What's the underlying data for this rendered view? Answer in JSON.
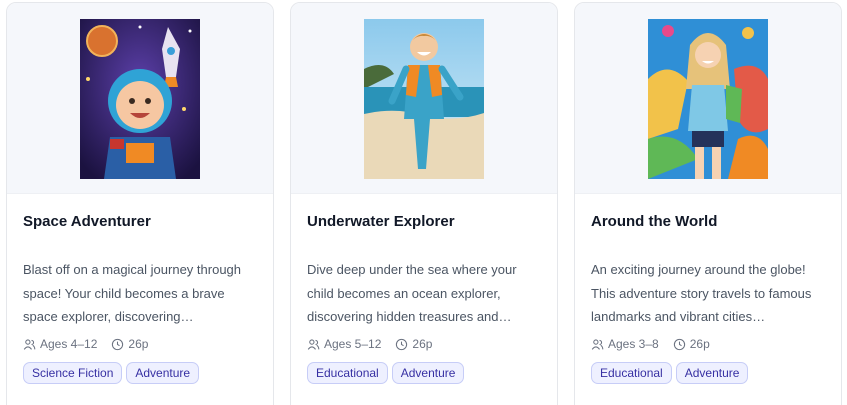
{
  "stories": [
    {
      "title": "Space Adventurer",
      "description": "Blast off on a magical journey through space! Your child becomes a brave space explorer, discovering…",
      "ages": "Ages 4–12",
      "pages": "26p",
      "tags": [
        "Science Fiction",
        "Adventure"
      ],
      "cover_icon": "astronaut-child-cover"
    },
    {
      "title": "Underwater Explorer",
      "description": "Dive deep under the sea where your child becomes an ocean explorer, discovering hidden treasures and…",
      "ages": "Ages 5–12",
      "pages": "26p",
      "tags": [
        "Educational",
        "Adventure"
      ],
      "cover_icon": "beach-diver-child-cover"
    },
    {
      "title": "Around the World",
      "description": "An exciting journey around the globe! This adventure story travels to famous landmarks and vibrant cities…",
      "ages": "Ages 3–8",
      "pages": "26p",
      "tags": [
        "Educational",
        "Adventure"
      ],
      "cover_icon": "world-traveler-child-cover"
    }
  ],
  "colors": {
    "tag_text": "#3730a3",
    "tag_bg": "#eef0ff",
    "tag_border": "#c7cdf7"
  }
}
